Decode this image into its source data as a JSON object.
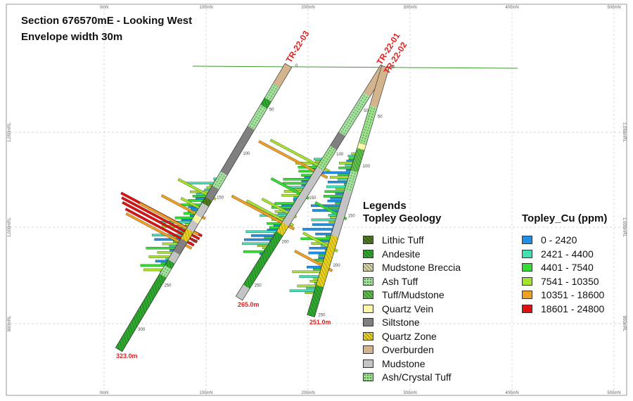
{
  "title": {
    "line1": "Section 676570mE - Looking West",
    "line2": "Envelope width 30m"
  },
  "axes": {
    "top": [
      {
        "label": "0mN",
        "col": 0
      },
      {
        "label": "100mN",
        "col": 1
      },
      {
        "label": "200mN",
        "col": 2
      },
      {
        "label": "300mN",
        "col": 3
      },
      {
        "label": "400mN",
        "col": 4
      },
      {
        "label": "500mN",
        "col": 5
      }
    ],
    "left": [
      {
        "label": "1,050mRL",
        "row": 0
      },
      {
        "label": "1,000mRL",
        "row": 1
      },
      {
        "label": "900mRL",
        "row": 2
      }
    ]
  },
  "holes": [
    {
      "id": "TR-22-03",
      "end_label": "323.0m",
      "depths": [
        "0",
        "50",
        "100",
        "150",
        "200",
        "250",
        "300"
      ]
    },
    {
      "id": "TR-22-01",
      "end_label": "265.0m",
      "depths": [
        "0",
        "50",
        "100",
        "150",
        "200",
        "250"
      ]
    },
    {
      "id": "TR-22-02",
      "end_label": "251.0m",
      "depths": [
        "0",
        "50",
        "100",
        "150",
        "200",
        "250"
      ]
    }
  ],
  "legend": {
    "heading_line1": "Legends",
    "geology_title": "Topley Geology",
    "geology": [
      {
        "label": "Lithic Tuff",
        "color": "#4f7a1f",
        "pattern": "hatch"
      },
      {
        "label": "Andesite",
        "color": "#2fa82f",
        "pattern": "hatch"
      },
      {
        "label": "Mudstone Breccia",
        "color": "#d6d3a0",
        "pattern": "hatch"
      },
      {
        "label": "Ash Tuff",
        "color": "#a6e0a0",
        "pattern": "dots"
      },
      {
        "label": "Tuff/Mudstone",
        "color": "#5cbf4a",
        "pattern": "hatch"
      },
      {
        "label": "Quartz Vein",
        "color": "#fdf6a8",
        "pattern": "solid"
      },
      {
        "label": "Siltstone",
        "color": "#808080",
        "pattern": "solid"
      },
      {
        "label": "Quartz Zone",
        "color": "#e8d020",
        "pattern": "hatch"
      },
      {
        "label": "Overburden",
        "color": "#d4b48c",
        "pattern": "solid"
      },
      {
        "label": "Mudstone",
        "color": "#c4c4c4",
        "pattern": "solid"
      },
      {
        "label": "Ash/Crystal Tuff",
        "color": "#9ee08e",
        "pattern": "dots"
      }
    ],
    "cu_title": "Topley_Cu (ppm)",
    "cu": [
      {
        "label": "0 - 2420",
        "color": "#1e90e6"
      },
      {
        "label": "2421 - 4400",
        "color": "#40e0b0"
      },
      {
        "label": "4401 - 7540",
        "color": "#33dd33"
      },
      {
        "label": "7541 - 10350",
        "color": "#a6e22a"
      },
      {
        "label": "10351 - 18600",
        "color": "#f0a020"
      },
      {
        "label": "18601 - 24800",
        "color": "#e01010"
      }
    ]
  }
}
